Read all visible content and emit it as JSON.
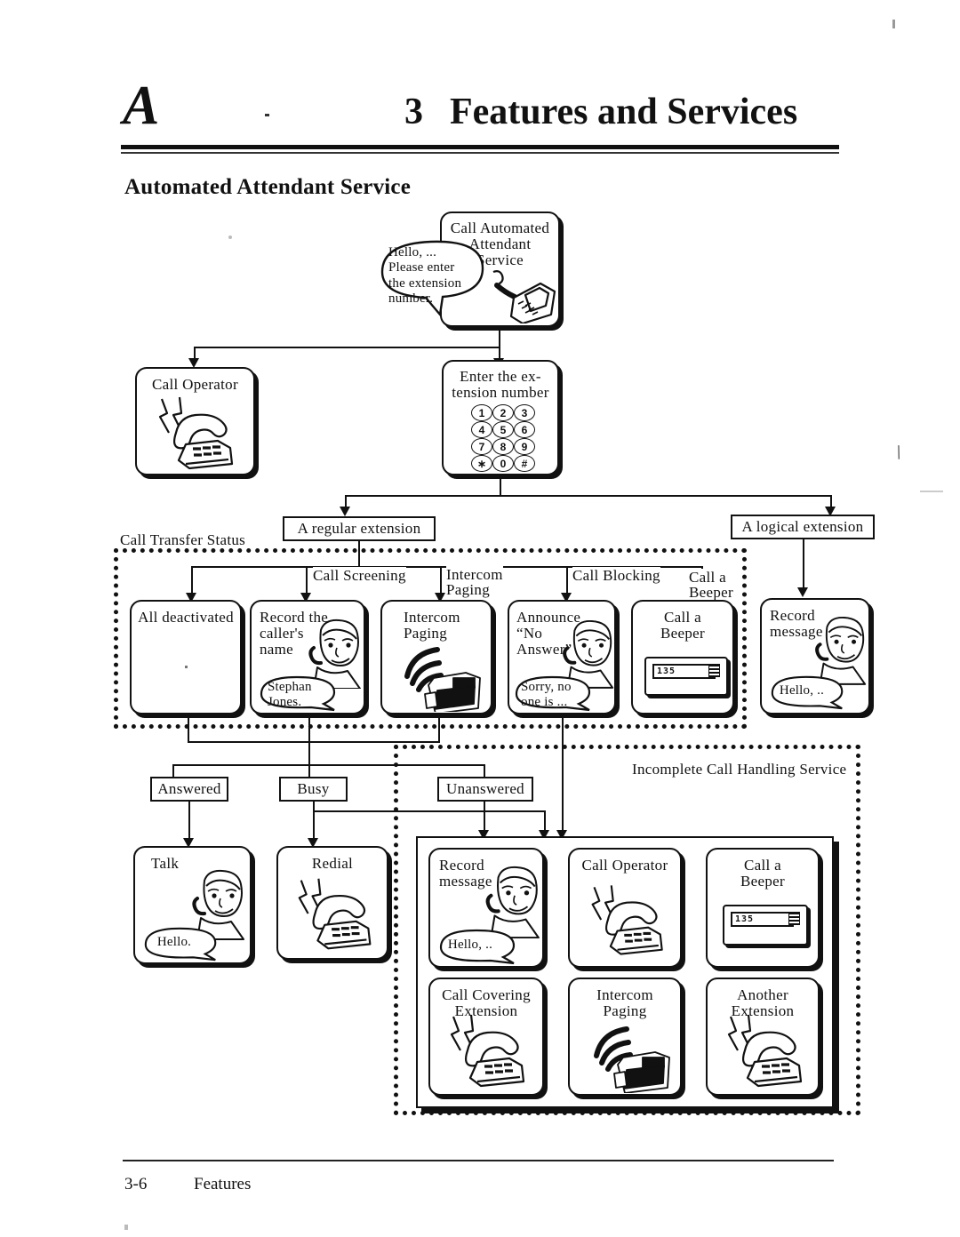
{
  "header": {
    "letter": "A",
    "chapter_number": "3",
    "chapter_title": "Features and Services",
    "section_title": "Automated Attendant Service"
  },
  "footer": {
    "page_number": "3-6",
    "label": "Features"
  },
  "flow": {
    "start": {
      "title_line1": "Call Automated",
      "title_line2": "Attendant",
      "title_line3": "Service",
      "bubble_line1": "Hello, ...",
      "bubble_line2": "Please enter",
      "bubble_line3": "the extension",
      "bubble_line4": "number."
    },
    "call_operator": {
      "title": "Call Operator"
    },
    "enter_extension": {
      "title_line1": "Enter the ex-",
      "title_line2": "tension number",
      "keys": [
        "1",
        "2",
        "3",
        "4",
        "5",
        "6",
        "7",
        "8",
        "9",
        "∗",
        "0",
        "#"
      ]
    },
    "regular_extension": {
      "label": "A regular extension"
    },
    "logical_extension": {
      "label": "A logical extension"
    },
    "call_transfer_status": {
      "label": "Call Transfer Status"
    },
    "incomplete_call_handling": {
      "label": "Incomplete Call Handling Service"
    },
    "branch_labels": {
      "call_screening": "Call Screening",
      "intercom_paging_l1": "Intercom",
      "intercom_paging_l2": "Paging",
      "call_blocking": "Call Blocking",
      "call_a_beeper_l1": "Call a",
      "call_a_beeper_l2": "Beeper"
    },
    "transfer_boxes": [
      {
        "name": "all-deactivated",
        "title_line1": "All deactivated",
        "title_line2": "",
        "bubble": ""
      },
      {
        "name": "record-callers-name",
        "title_line1": "Record the",
        "title_line2": "caller's",
        "title_line3": "name",
        "bubble_line1": "Stephan",
        "bubble_line2": "Jones."
      },
      {
        "name": "intercom-paging",
        "title_line1": "Intercom",
        "title_line2": "Paging"
      },
      {
        "name": "announce-no-answer",
        "title_line1": "Announce",
        "title_line2": "“No",
        "title_line3": "Answer”",
        "bubble_line1": "Sorry, no",
        "bubble_line2": "one is ..."
      },
      {
        "name": "call-a-beeper",
        "title_line1": "Call a",
        "title_line2": "Beeper",
        "beeper_display": "135"
      }
    ],
    "logical_box": {
      "name": "record-message-logical",
      "title_line1": "Record",
      "title_line2": "message",
      "bubble": "Hello, .."
    },
    "status_boxes": [
      {
        "label": "Answered"
      },
      {
        "label": "Busy"
      },
      {
        "label": "Unanswered"
      }
    ],
    "result_boxes": [
      {
        "name": "talk",
        "title": "Talk",
        "bubble": "Hello."
      },
      {
        "name": "redial",
        "title": "Redial"
      }
    ],
    "incomplete_boxes": [
      {
        "name": "record-message",
        "title_line1": "Record",
        "title_line2": "message",
        "bubble": "Hello, .."
      },
      {
        "name": "call-operator",
        "title_line1": "Call Operator",
        "title_line2": ""
      },
      {
        "name": "call-a-beeper",
        "title_line1": "Call a",
        "title_line2": "Beeper",
        "beeper_display": "135"
      },
      {
        "name": "call-covering-extension",
        "title_line1": "Call Covering",
        "title_line2": "Extension"
      },
      {
        "name": "intercom-paging",
        "title_line1": "Intercom",
        "title_line2": "Paging"
      },
      {
        "name": "another-extension",
        "title_line1": "Another",
        "title_line2": "Extension"
      }
    ]
  }
}
